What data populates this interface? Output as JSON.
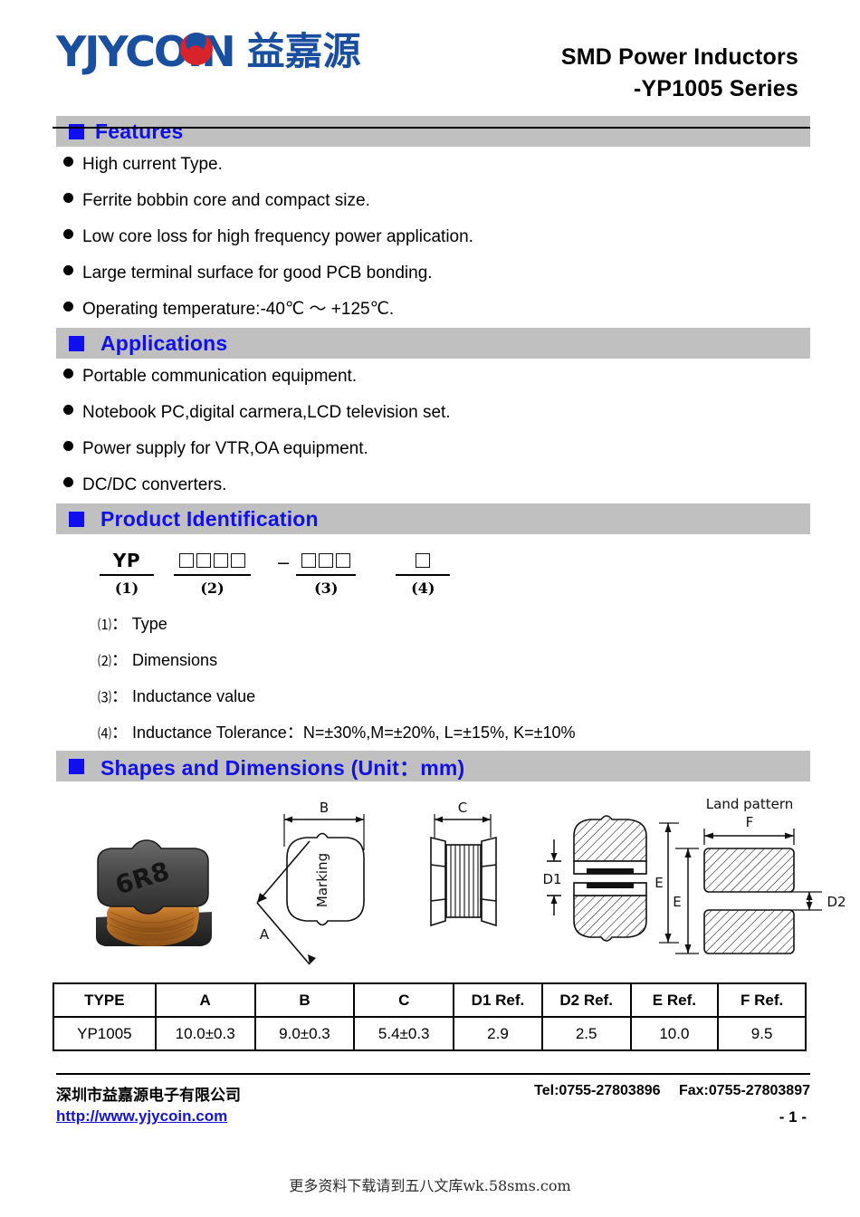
{
  "header": {
    "logo_text": "YJYCOIN",
    "logo_text_part1": "YJYC",
    "logo_text_part2": "IN",
    "logo_cn": "益嘉源",
    "title_line1": "SMD Power Inductors",
    "title_line2": "-YP1005 Series"
  },
  "features": {
    "heading": "Features",
    "items": [
      "High current Type.",
      "Ferrite bobbin core and compact size.",
      "Low core loss for high frequency power application.",
      "Large terminal surface for good PCB bonding.",
      "Operating temperature:-40℃ ～ +125℃."
    ]
  },
  "applications": {
    "heading": "Applications",
    "items": [
      "Portable communication equipment.",
      "Notebook PC,digital carmera,LCD television set.",
      "Power supply for VTR,OA equipment.",
      "DC/DC converters."
    ]
  },
  "product_identification": {
    "heading": "Product Identification",
    "diagram": {
      "group1_value": "YP",
      "group1_label": "(1)",
      "group2_boxes": 4,
      "group2_label": "(2)",
      "separator": "–",
      "group3_boxes": 3,
      "group3_label": "(3)",
      "group4_boxes": 1,
      "group4_label": "(4)"
    },
    "legend": [
      {
        "index": "⑴",
        "colon": "：",
        "text": "Type"
      },
      {
        "index": "⑵",
        "colon": "：",
        "text": "Dimensions"
      },
      {
        "index": "⑶",
        "colon": "：",
        "text": "Inductance value"
      },
      {
        "index": "⑷",
        "colon": "：",
        "text": "Inductance Tolerance：N=±30%,M=±20%, L=±15%, K=±10%"
      }
    ]
  },
  "shapes": {
    "heading": "Shapes and Dimensions (Unit：mm)",
    "photo_marking": "6R8",
    "labels": {
      "a": "A",
      "b": "B",
      "c": "C",
      "marking": "Marking",
      "d1": "D1",
      "d2": "D2",
      "e_left": "E",
      "e_right": "E",
      "f": "F",
      "land_pattern": "Land pattern"
    }
  },
  "dimensions_table": {
    "columns": [
      "TYPE",
      "A",
      "B",
      "C",
      "D1 Ref.",
      "D2 Ref.",
      "E Ref.",
      "F Ref."
    ],
    "rows": [
      [
        "YP1005",
        "10.0±0.3",
        "9.0±0.3",
        "5.4±0.3",
        "2.9",
        "2.5",
        "10.0",
        "9.5"
      ]
    ]
  },
  "footer": {
    "company_cn": "深圳市益嘉源电子有限公司",
    "website": "http://www.yjycoin.com",
    "tel": "Tel:0755-27803896",
    "fax": "Fax:0755-27803897",
    "page_number": "- 1 -",
    "watermark": "更多资料下载请到五八文库wk.58sms.com"
  },
  "colors": {
    "band_bg": "#C0C0C0",
    "heading_blue": "#1010EF",
    "logo_blue": "#1A4FA0",
    "logo_red": "#D8232A",
    "link_blue": "#1414D2"
  }
}
